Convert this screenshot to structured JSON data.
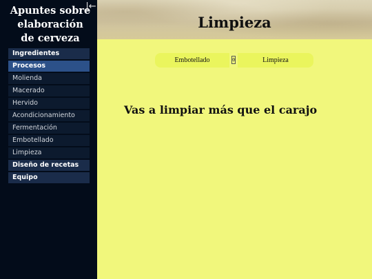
{
  "sidebar": {
    "site_title": "Apuntes sobre elaboración de cerveza",
    "collapse_icon": "collapse-left-arrow-icon",
    "collapse_glyph": "|←",
    "items": [
      {
        "label": "Ingredientes"
      },
      {
        "label": "Procesos"
      },
      {
        "label": "Molienda"
      },
      {
        "label": "Macerado"
      },
      {
        "label": "Hervido"
      },
      {
        "label": "Acondicionamiento"
      },
      {
        "label": "Fermentación"
      },
      {
        "label": "Embotellado"
      },
      {
        "label": "Limpieza"
      },
      {
        "label": "Diseño de recetas"
      },
      {
        "label": "Equipo"
      }
    ]
  },
  "header": {
    "title": "Limpieza"
  },
  "breadcrumb": {
    "items": [
      "Embotellado",
      "Limpieza"
    ],
    "separator": "0"
  },
  "main": {
    "heading": "Vas a limpiar más que el carajo"
  },
  "colors": {
    "sidebar_bg": "#030c1a",
    "active_item": "#2c5189",
    "content_bg": "#f1f77c",
    "breadcrumb_bg": "#eaf55d"
  }
}
